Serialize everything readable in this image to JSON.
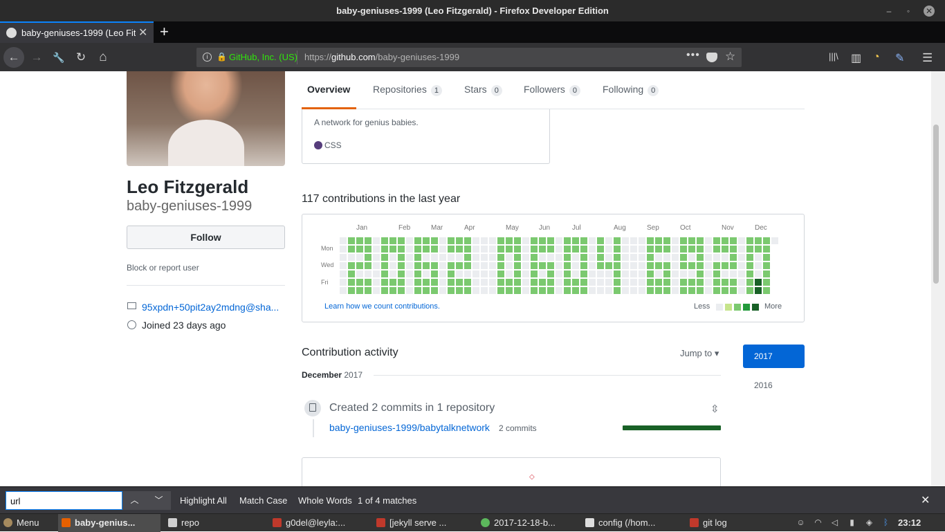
{
  "window": {
    "title": "baby-geniuses-1999 (Leo Fitzgerald) - Firefox Developer Edition",
    "minimize_glyph": "–",
    "restore_glyph": "◦",
    "close_glyph": "✕"
  },
  "browser": {
    "tab_title": "baby-geniuses-1999 (Leo Fitz",
    "tab_close": "✕",
    "new_tab": "+",
    "identity": "GitHub, Inc. (US)",
    "url_prefix": "https://",
    "url_host": "github.com",
    "url_path": "/baby-geniuses-1999",
    "more_glyph": "•••",
    "star_glyph": "☆",
    "back_glyph": "←",
    "forward_glyph": "→",
    "reload_glyph": "↻",
    "home_glyph": "⌂",
    "tools_glyph": "🔧",
    "library_glyph": "|||\\",
    "sidebar_glyph": "▥",
    "colors_glyph": "◔",
    "pen_glyph": "✎",
    "menu_glyph": "☰",
    "info_glyph": "i",
    "lock_glyph": "🔒"
  },
  "profile": {
    "full_name": "Leo Fitzgerald",
    "username": "baby-geniuses-1999",
    "follow_label": "Follow",
    "block_label": "Block or report user",
    "email": "95xpdn+50pit2ay2mdng@sha...",
    "joined": "Joined 23 days ago"
  },
  "tabs": [
    {
      "label": "Overview",
      "count": ""
    },
    {
      "label": "Repositories",
      "count": "1"
    },
    {
      "label": "Stars",
      "count": "0"
    },
    {
      "label": "Followers",
      "count": "0"
    },
    {
      "label": "Following",
      "count": "0"
    }
  ],
  "repo_card": {
    "description": "A network for genius babies.",
    "language": "CSS",
    "language_color": "#563d7c"
  },
  "contributions": {
    "heading": "117 contributions in the last year",
    "months": [
      "Jan",
      "Feb",
      "Mar",
      "Apr",
      "May",
      "Jun",
      "Jul",
      "Aug",
      "Sep",
      "Oct",
      "Nov",
      "Dec"
    ],
    "weekdays": [
      "Mon",
      "Wed",
      "Fri"
    ],
    "learn_link": "Learn how we count contributions.",
    "legend_less": "Less",
    "legend_more": "More",
    "levels": [
      "#ebedf0",
      "#c6e48b",
      "#7bc96f",
      "#239a3b",
      "#196127"
    ]
  },
  "activity": {
    "heading": "Contribution activity",
    "jump_to": "Jump to ▾",
    "years": [
      "2017",
      "2016"
    ],
    "month": "December",
    "month_year": "2017",
    "commits_title": "Created 2 commits in 1 repository",
    "repo": "baby-geniuses-1999/babytalknetwork",
    "repo_commits": "2 commits",
    "fold_glyph": "⇳",
    "bottom_glyph": "◇"
  },
  "findbar": {
    "query": "url",
    "up_glyph": "︿",
    "down_glyph": "﹀",
    "highlight_all": "Highlight All",
    "match_case": "Match Case",
    "whole_words": "Whole Words",
    "matches": "1 of 4 matches",
    "close_glyph": "✕"
  },
  "taskbar": {
    "menu": "Menu",
    "items": [
      "baby-genius...",
      "repo",
      "g0del@leyla:...",
      "[jekyll serve ...",
      "2017-12-18-b...",
      "config (/hom...",
      "git log"
    ],
    "clock": "23:12"
  }
}
